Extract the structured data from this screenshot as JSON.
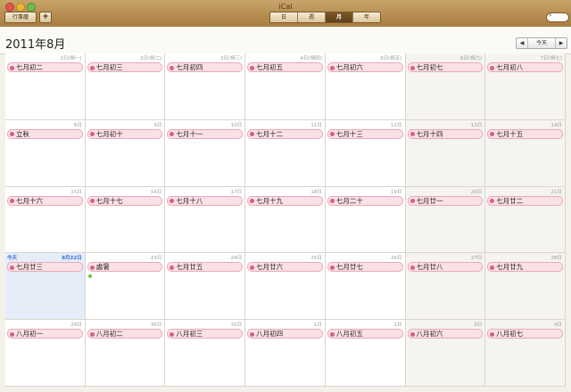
{
  "window": {
    "title": "iCal"
  },
  "toolbar": {
    "calendars_label": "行事曆",
    "add_label": "+",
    "views": [
      "日",
      "週",
      "月",
      "年"
    ],
    "active_view": 2,
    "search_icon": "search-icon"
  },
  "header": {
    "month_title": "2011年8月",
    "prev_label": "◀",
    "today_label": "今天",
    "next_label": "▶"
  },
  "calendar": {
    "today_label": "今天",
    "today_date": "8月22日",
    "event_color": "#fbe1e7",
    "weeks": [
      [
        {
          "date": "1日(朔一)",
          "event": "七月初二"
        },
        {
          "date": "2日(朔二)",
          "event": "七月初三"
        },
        {
          "date": "3日(朔三)",
          "event": "七月初四"
        },
        {
          "date": "4日(朔四)",
          "event": "七月初五"
        },
        {
          "date": "5日(朔五)",
          "event": "七月初六"
        },
        {
          "date": "6日(朔六)",
          "event": "七月初七"
        },
        {
          "date": "7日(朔七)",
          "event": "七月初八"
        }
      ],
      [
        {
          "date": "8日",
          "event": "立秋"
        },
        {
          "date": "9日",
          "event": "七月初十"
        },
        {
          "date": "10日",
          "event": "七月十一"
        },
        {
          "date": "11日",
          "event": "七月十二"
        },
        {
          "date": "12日",
          "event": "七月十三"
        },
        {
          "date": "13日",
          "event": "七月十四"
        },
        {
          "date": "14日",
          "event": "七月十五"
        }
      ],
      [
        {
          "date": "15日",
          "event": "七月十六"
        },
        {
          "date": "16日",
          "event": "七月十七"
        },
        {
          "date": "17日",
          "event": "七月十八"
        },
        {
          "date": "18日",
          "event": "七月十九"
        },
        {
          "date": "19日",
          "event": "七月二十"
        },
        {
          "date": "20日",
          "event": "七月廿一"
        },
        {
          "date": "21日",
          "event": "七月廿二"
        }
      ],
      [
        {
          "date": "",
          "event": "七月廿三"
        },
        {
          "date": "23日",
          "event": "處暑"
        },
        {
          "date": "24日",
          "event": "七月廿五"
        },
        {
          "date": "25日",
          "event": "七月廿六"
        },
        {
          "date": "26日",
          "event": "七月廿七"
        },
        {
          "date": "27日",
          "event": "七月廿八"
        },
        {
          "date": "28日",
          "event": "七月廿九"
        }
      ],
      [
        {
          "date": "29日",
          "event": "八月初一"
        },
        {
          "date": "30日",
          "event": "八月初二"
        },
        {
          "date": "31日",
          "event": "八月初三"
        },
        {
          "date": "1日",
          "event": "八月初四"
        },
        {
          "date": "2日",
          "event": "八月初五"
        },
        {
          "date": "3日",
          "event": "八月初六"
        },
        {
          "date": "4日",
          "event": "八月初七"
        }
      ]
    ]
  }
}
